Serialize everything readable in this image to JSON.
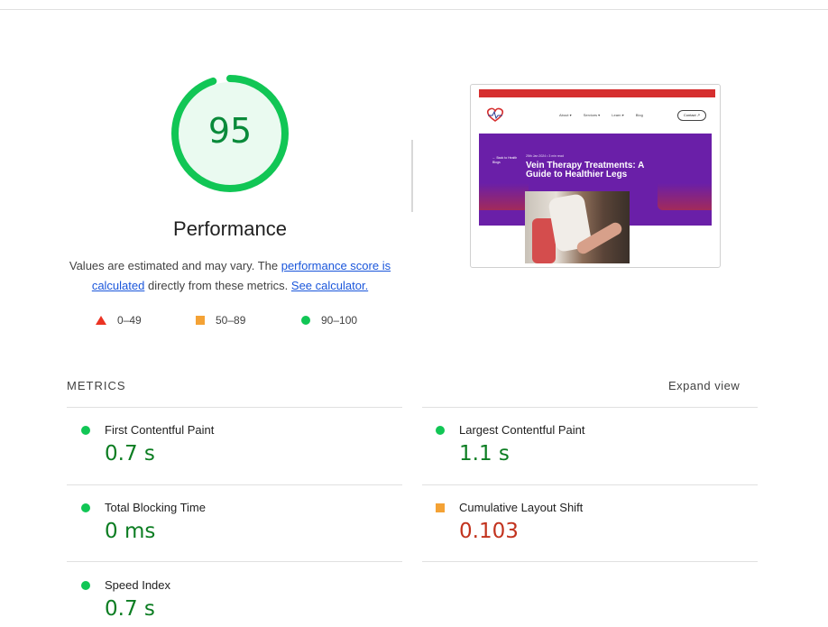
{
  "colors": {
    "pass": "#11c655",
    "average": "#f4a235",
    "fail": "#eb3323",
    "pass_text": "#0c7d22",
    "average_text": "#c2331e"
  },
  "gauge": {
    "score": "95",
    "title": "Performance",
    "progress": 0.95
  },
  "description": {
    "text1": "Values are estimated and may vary. The ",
    "link1": "performance score is calculated",
    "text2": " directly from these metrics. ",
    "link2": "See calculator."
  },
  "legend": [
    {
      "label": "0–49",
      "icon": "triangle-fail-icon"
    },
    {
      "label": "50–89",
      "icon": "square-average-icon"
    },
    {
      "label": "90–100",
      "icon": "circle-pass-icon"
    }
  ],
  "thumbnail": {
    "nav": [
      "About ▾",
      "Services ▾",
      "Learn ▾",
      "Blog"
    ],
    "contact": "Contact ↗",
    "back": "← Back to Health Blogs",
    "date": "25th Jan 2024  •  3 min read",
    "headline": "Vein Therapy Treatments: A Guide to Healthier Legs"
  },
  "metrics": {
    "title": "METRICS",
    "expand": "Expand view",
    "items": [
      {
        "name": "First Contentful Paint",
        "value": "0.7 s",
        "status": "pass"
      },
      {
        "name": "Largest Contentful Paint",
        "value": "1.1 s",
        "status": "pass"
      },
      {
        "name": "Total Blocking Time",
        "value": "0 ms",
        "status": "pass"
      },
      {
        "name": "Cumulative Layout Shift",
        "value": "0.103",
        "status": "average"
      },
      {
        "name": "Speed Index",
        "value": "0.7 s",
        "status": "pass"
      }
    ]
  }
}
